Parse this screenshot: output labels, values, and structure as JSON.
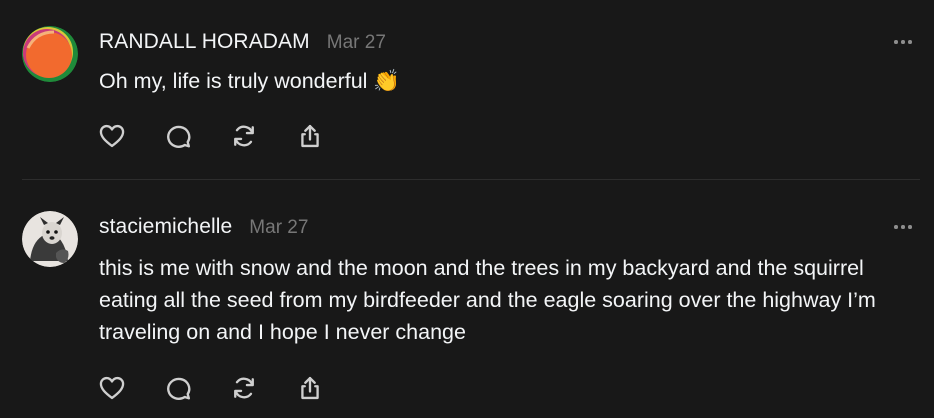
{
  "posts": [
    {
      "username": "RANDALL HORADAM",
      "date": "Mar 27",
      "text": "Oh my, life is truly wonderful 👏",
      "avatar_icon": "orange-circle-avatar",
      "more_icon": "ellipsis-icon"
    },
    {
      "username": "staciemichelle",
      "date": "Mar 27",
      "text": "this is me with snow and the moon and the trees in my backyard and the squirrel eating all the seed from my birdfeeder and the eagle soaring over the highway I’m traveling on and I hope I never change",
      "avatar_icon": "dog-photo-avatar",
      "more_icon": "ellipsis-icon"
    }
  ],
  "actions": [
    "like-icon",
    "comment-icon",
    "repost-icon",
    "share-icon"
  ],
  "colors": {
    "background": "#181818",
    "text": "#f3f5f7",
    "muted": "#777777",
    "icon": "#cfcfcf"
  }
}
